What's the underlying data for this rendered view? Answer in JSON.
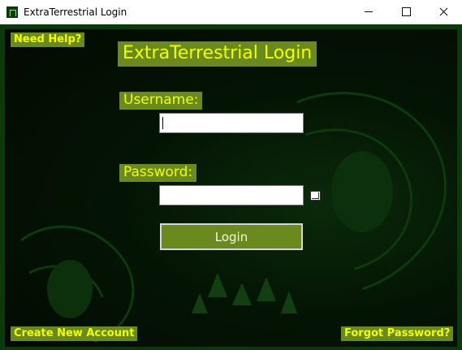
{
  "window": {
    "title": "ExtraTerrestrial Login",
    "app_icon": "app-icon"
  },
  "caption": {
    "minimize_icon": "minimize-icon",
    "maximize_icon": "maximize-icon",
    "close_icon": "close-icon"
  },
  "colors": {
    "label_bg": "#6b8a1e",
    "label_text": "#f2ff00",
    "background": "#031603",
    "frame": "#0a3a0a"
  },
  "login": {
    "need_help": "Need Help?",
    "heading": "ExtraTerrestrial Login",
    "username_label": "Username:",
    "username_value": "",
    "password_label": "Password:",
    "password_value": "",
    "show_password_icon": "checkbox-icon",
    "login_button": "Login",
    "create_account": "Create New Account",
    "forgot_password": "Forgot Password?"
  }
}
